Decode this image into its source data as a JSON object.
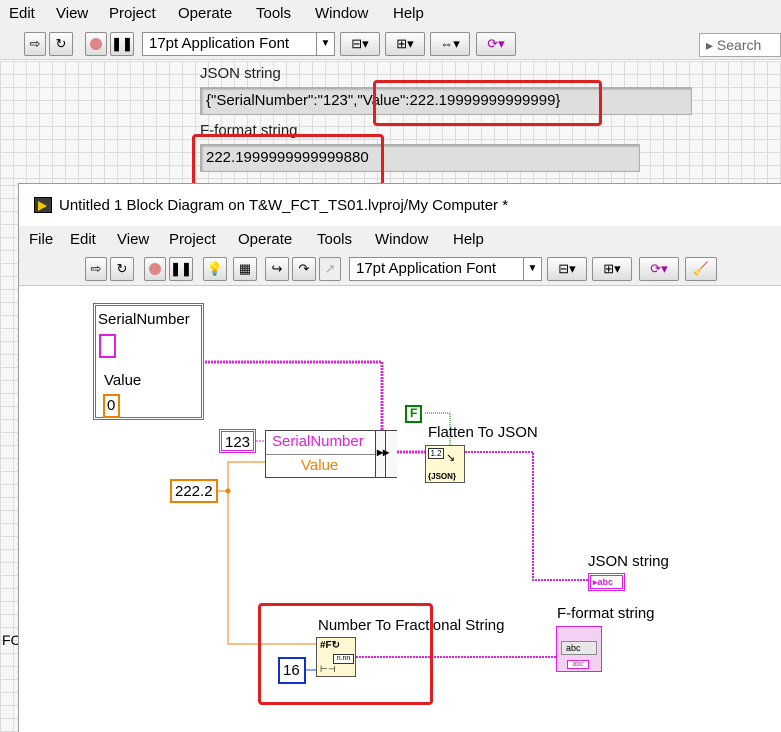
{
  "front_panel": {
    "menu": [
      "Edit",
      "View",
      "Project",
      "Operate",
      "Tools",
      "Window",
      "Help"
    ],
    "font_selector": "17pt Application Font",
    "search_placeholder": "Search",
    "json_label": "JSON string",
    "json_value": "{\"SerialNumber\":\"123\",\"Value\":222.19999999999999}",
    "fformat_label": "F-format string",
    "fformat_value": "222.1999999999999880",
    "left_edge_text": "FC"
  },
  "block_diagram": {
    "title": "Untitled 1 Block Diagram on T&W_FCT_TS01.lvproj/My Computer *",
    "menu": [
      "File",
      "Edit",
      "View",
      "Project",
      "Operate",
      "Tools",
      "Window",
      "Help"
    ],
    "font_selector": "17pt Application Font",
    "cluster_control": {
      "field1_label": "SerialNumber",
      "field2_label": "Value",
      "field2_value": "0"
    },
    "bundle": {
      "const_value": "123",
      "element1": "SerialNumber",
      "element2": "Value"
    },
    "value_const": "222.2",
    "false_const": "F",
    "flatten_label": "Flatten To JSON",
    "flatten_icon_text": "{JSON}",
    "json_indicator_label": "JSON string",
    "number_to_string_label": "Number To Fractional String",
    "precision_const": "16",
    "fformat_indicator_label": "F-format string",
    "string_glyph": "abc",
    "colors": {
      "string_wire": "#e020e0",
      "numeric_wire": "#f08000",
      "boolean_wire": "#008000",
      "highlight": "#e02020"
    }
  }
}
